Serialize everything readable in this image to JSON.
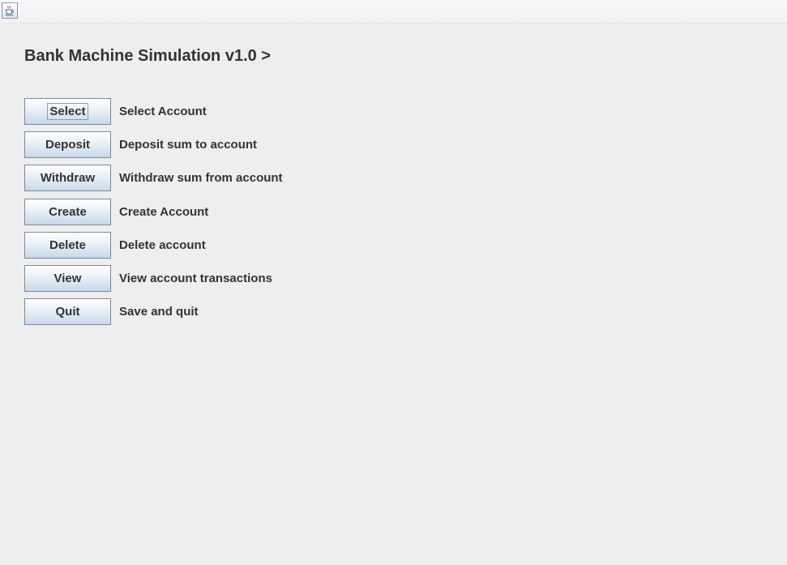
{
  "window": {
    "app_icon": "java-coffee-cup-icon"
  },
  "heading": "Bank Machine Simulation v1.0 >",
  "menu": {
    "items": [
      {
        "button": "Select",
        "description": "Select Account"
      },
      {
        "button": "Deposit",
        "description": "Deposit sum to account"
      },
      {
        "button": "Withdraw",
        "description": "Withdraw sum from account"
      },
      {
        "button": "Create",
        "description": "Create Account"
      },
      {
        "button": "Delete",
        "description": "Delete account"
      },
      {
        "button": "View",
        "description": "View account transactions"
      },
      {
        "button": "Quit",
        "description": "Save and quit"
      }
    ]
  }
}
